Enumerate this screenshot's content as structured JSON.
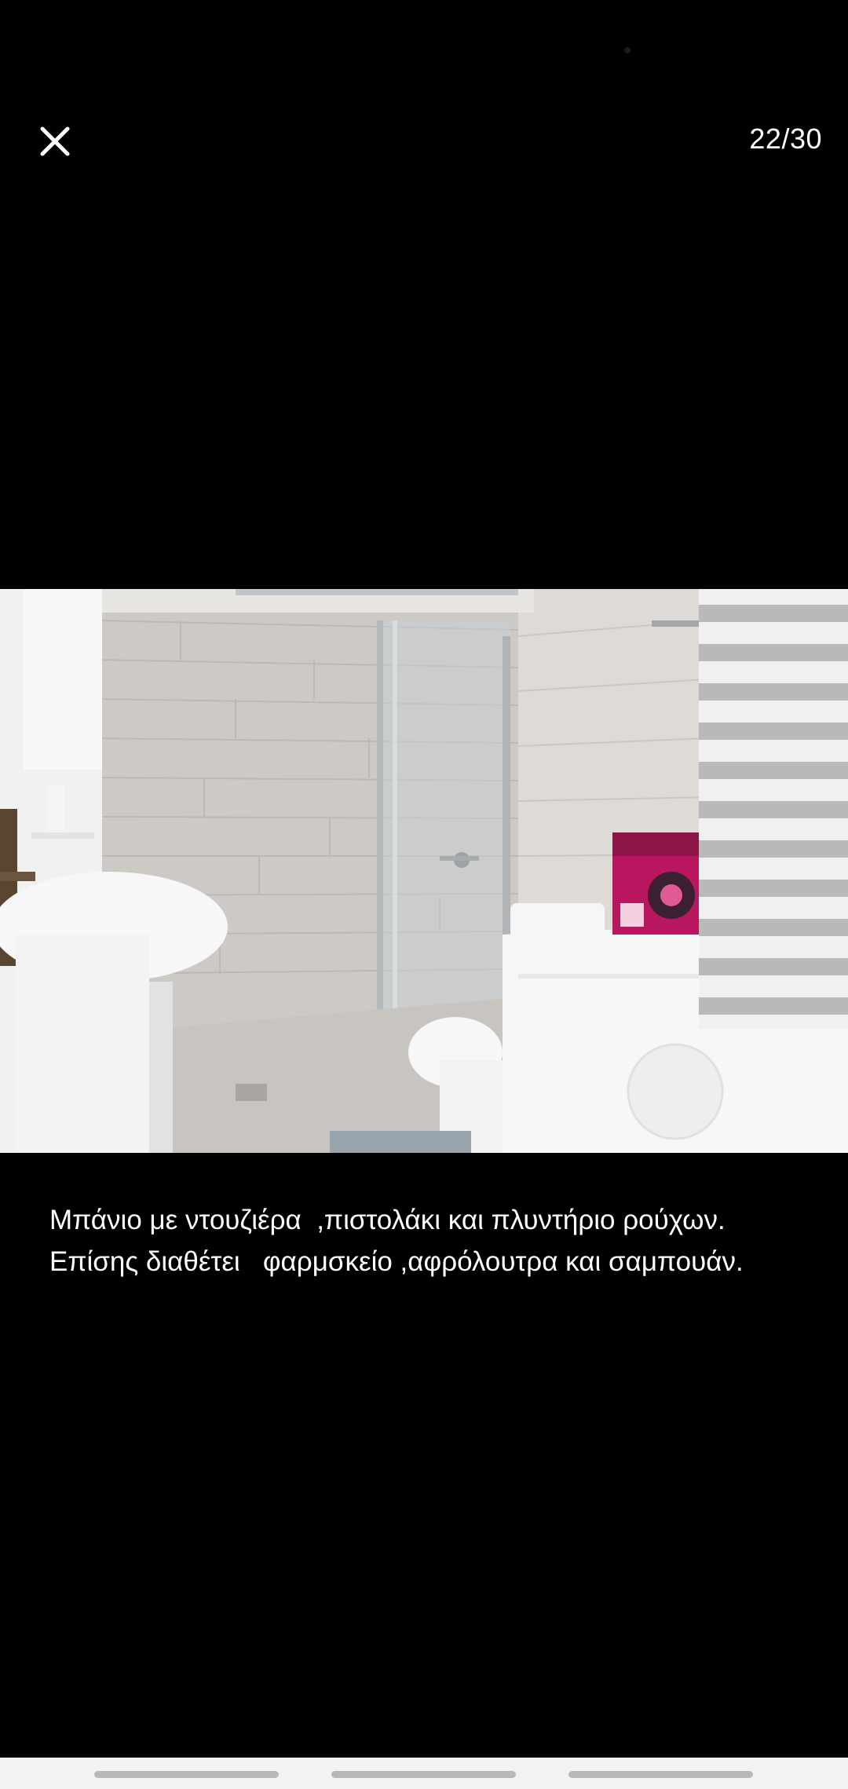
{
  "viewer": {
    "counter": "22/30",
    "caption": "Μπάνιο με ντουζιέρα  ,πιστολάκι και πλυντήριο ρούχων. Επίσης διαθέτει   φαρμσκείο ,αφρόλουτρα και σαμπουάν."
  },
  "photo": {
    "subject": "bathroom-with-shower-washing-machine-hairdryer"
  },
  "icons": {
    "close": "close-icon"
  },
  "colors": {
    "background": "#000000",
    "text": "#ffffff",
    "nav_bar": "#f2f2f2"
  }
}
